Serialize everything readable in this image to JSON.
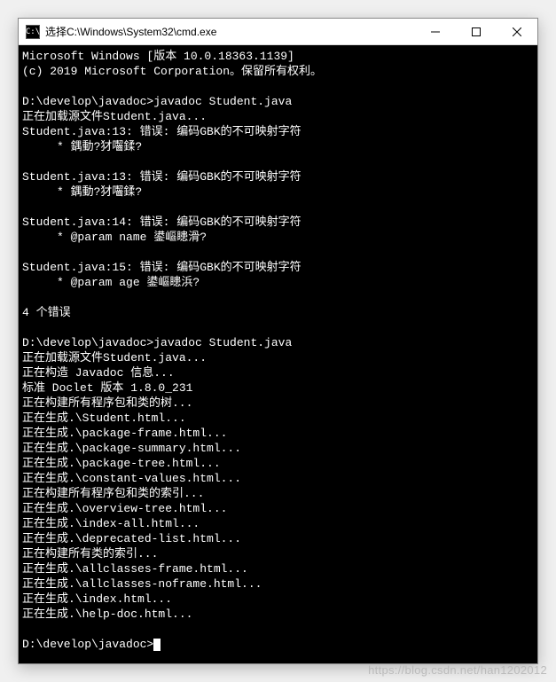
{
  "window": {
    "title": "选择C:\\Windows\\System32\\cmd.exe",
    "icon_label": "C:\\"
  },
  "console": {
    "lines": [
      "Microsoft Windows [版本 10.0.18363.1139]",
      "(c) 2019 Microsoft Corporation。保留所有权利。",
      "",
      "D:\\develop\\javadoc>javadoc Student.java",
      "正在加载源文件Student.java...",
      "Student.java:13: 错误: 编码GBK的不可映射字符",
      "     * 鍝動?犲囓鍒?",
      "",
      "Student.java:13: 错误: 编码GBK的不可映射字符",
      "     * 鍝動?犲囓鍒?",
      "",
      "Student.java:14: 错误: 编码GBK的不可映射字符",
      "     * @param name 鍙嶇瞣滑?",
      "",
      "Student.java:15: 错误: 编码GBK的不可映射字符",
      "     * @param age 鍙嶇瞣浜?",
      "",
      "4 个错误",
      "",
      "D:\\develop\\javadoc>javadoc Student.java",
      "正在加载源文件Student.java...",
      "正在构造 Javadoc 信息...",
      "标准 Doclet 版本 1.8.0_231",
      "正在构建所有程序包和类的树...",
      "正在生成.\\Student.html...",
      "正在生成.\\package-frame.html...",
      "正在生成.\\package-summary.html...",
      "正在生成.\\package-tree.html...",
      "正在生成.\\constant-values.html...",
      "正在构建所有程序包和类的索引...",
      "正在生成.\\overview-tree.html...",
      "正在生成.\\index-all.html...",
      "正在生成.\\deprecated-list.html...",
      "正在构建所有类的索引...",
      "正在生成.\\allclasses-frame.html...",
      "正在生成.\\allclasses-noframe.html...",
      "正在生成.\\index.html...",
      "正在生成.\\help-doc.html...",
      "",
      "D:\\develop\\javadoc>"
    ]
  },
  "watermark": "https://blog.csdn.net/han1202012"
}
